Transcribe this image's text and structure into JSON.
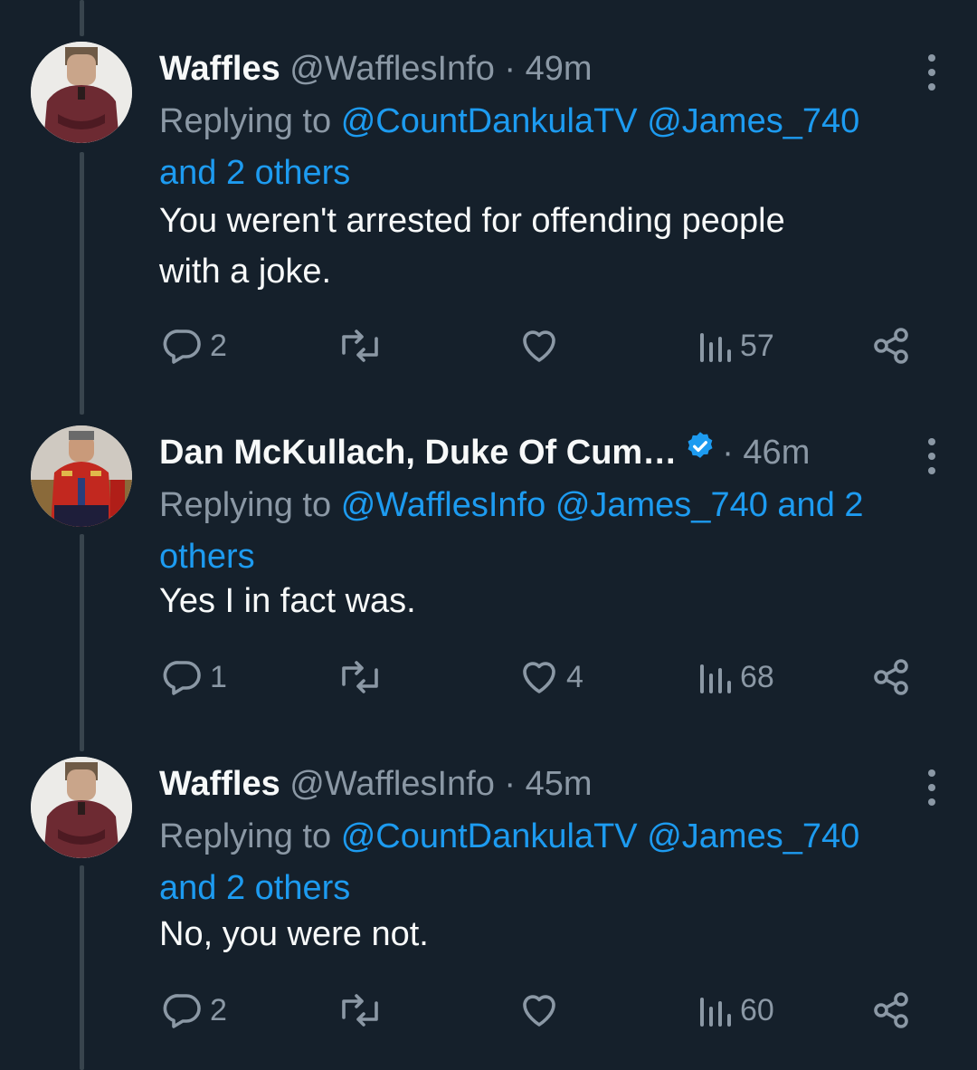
{
  "tweets": [
    {
      "name": "Waffles",
      "handle": "@WafflesInfo",
      "dot": "·",
      "time": "49m",
      "replying_prefix": "Replying to",
      "mentions": [
        "@CountDankulaTV",
        "@James_740"
      ],
      "and_others": "and 2 others",
      "text_lines": [
        "You weren't arrested for offending people",
        "with a joke."
      ],
      "stats": {
        "replies": "2",
        "reposts": "",
        "likes": "",
        "views": "57"
      },
      "avatar": "waffles-avatar"
    },
    {
      "name": "Dan McKullach, Duke Of Cum…",
      "verified": true,
      "handle": "",
      "dot": "·",
      "time": "46m",
      "replying_prefix": "Replying to",
      "mentions": [
        "@WafflesInfo",
        "@James_740"
      ],
      "and_others": "and 2 others",
      "text_lines": [
        "Yes I in fact was."
      ],
      "stats": {
        "replies": "1",
        "reposts": "",
        "likes": "4",
        "views": "68"
      },
      "avatar": "duke-avatar"
    },
    {
      "name": "Waffles",
      "handle": "@WafflesInfo",
      "dot": "·",
      "time": "45m",
      "replying_prefix": "Replying to",
      "mentions": [
        "@CountDankulaTV",
        "@James_740"
      ],
      "and_others": "and 2 others",
      "text_lines": [
        "No, you were not."
      ],
      "stats": {
        "replies": "2",
        "reposts": "",
        "likes": "",
        "views": "60"
      },
      "avatar": "waffles-avatar"
    }
  ],
  "icons": {
    "reply": "reply-icon",
    "repost": "repost-icon",
    "like": "heart-icon",
    "views": "views-icon",
    "share": "share-icon",
    "more": "more-icon",
    "verified": "verified-badge-icon"
  },
  "colors": {
    "background": "#15202b",
    "text": "#f7f9f9",
    "secondary": "#8b98a5",
    "accent": "#1d9bf0",
    "thread_line": "#38444d"
  }
}
